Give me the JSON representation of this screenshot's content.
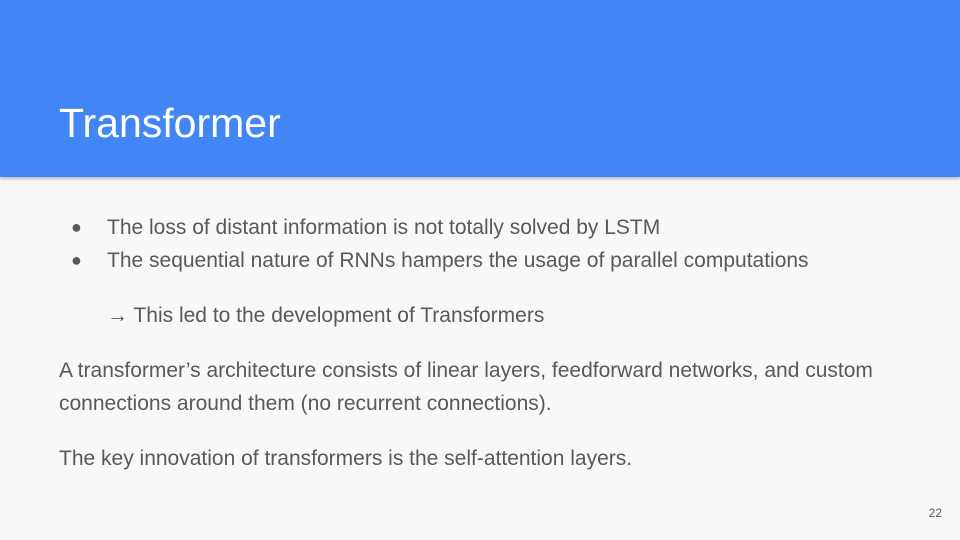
{
  "slide": {
    "title": "Transformer",
    "bullets": [
      "The loss of distant information is not totally solved by LSTM",
      "The sequential nature of RNNs hampers the usage of parallel computations"
    ],
    "bullet_marker": "●",
    "arrow_line": "→ This led to the development of Transformers",
    "paragraphs": [
      "A transformer’s architecture consists of linear layers, feedforward networks, and custom connections around them (no recurrent connections).",
      "The key innovation of transformers is the self-attention layers."
    ],
    "page_number": "22",
    "colors": {
      "header_band": "#4285f4",
      "title_text": "#ffffff",
      "body_text": "#595959",
      "background": "#f8f8f8"
    }
  }
}
